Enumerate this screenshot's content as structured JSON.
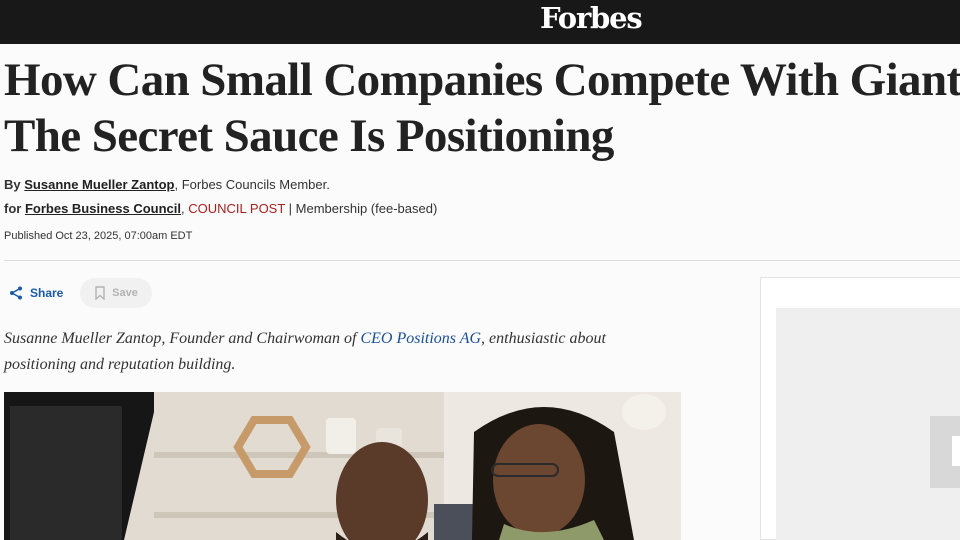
{
  "header": {
    "logo": "Forbes"
  },
  "article": {
    "headline_line1": "How Can Small Companies Compete With Giants?",
    "headline_line2": "The Secret Sauce Is Positioning",
    "by_prefix": "By",
    "author": "Susanne Mueller Zantop",
    "author_suffix": ", Forbes Councils Member.",
    "for_prefix": "for",
    "council_name": "Forbes Business Council",
    "comma": ",",
    "council_post": "COUNCIL POST",
    "membership": " | Membership (fee-based)",
    "published": "Published Oct 23, 2025, 07:00am EDT"
  },
  "actions": {
    "share_label": "Share",
    "save_label": "Save"
  },
  "bio": {
    "part1": "Susanne Mueller Zantop, Founder and Chairwoman of ",
    "link": "CEO Positions AG",
    "part2": ", enthusiastic about positioning and reputation building."
  },
  "colors": {
    "topbar": "#181818",
    "link": "#1a4f96",
    "council_post": "#a72020",
    "share": "#1a5aa8"
  }
}
